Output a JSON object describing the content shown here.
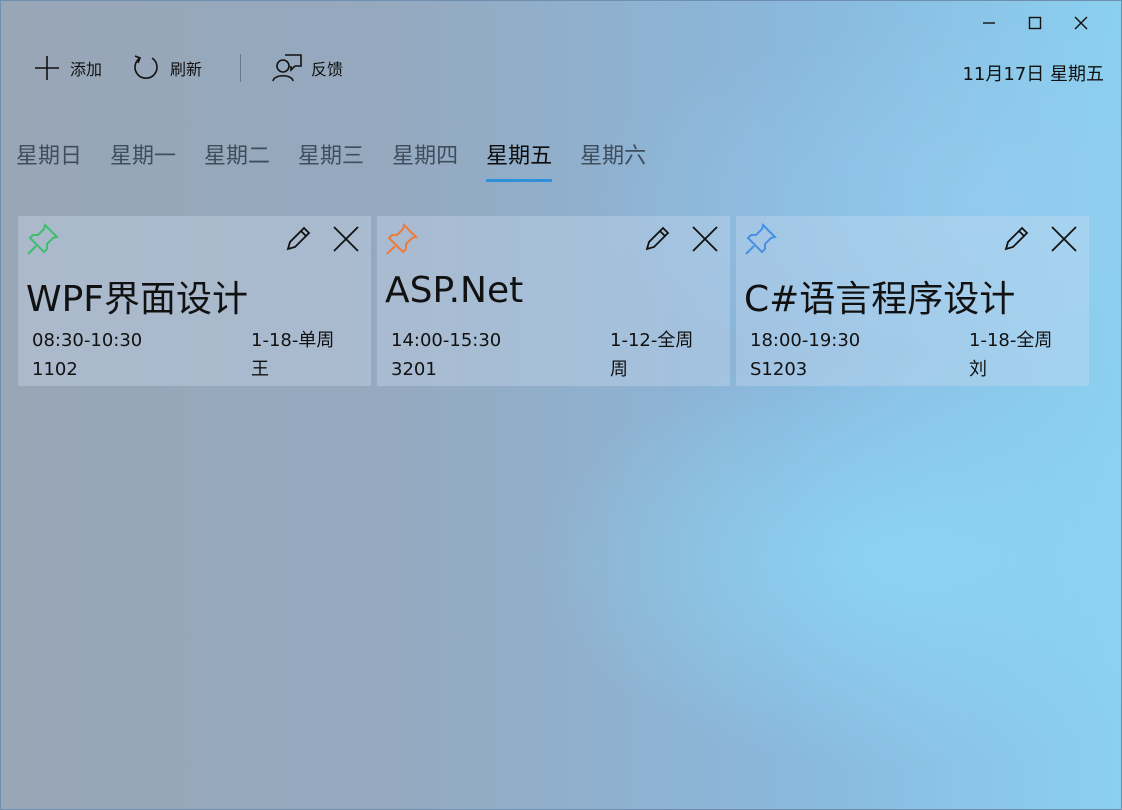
{
  "window": {
    "controls": [
      "minimize",
      "maximize",
      "close"
    ]
  },
  "toolbar": {
    "add_label": "添加",
    "refresh_label": "刷新",
    "feedback_label": "反馈",
    "date_label": "11月17日 星期五"
  },
  "tabs": [
    {
      "label": "星期日",
      "active": false
    },
    {
      "label": "星期一",
      "active": false
    },
    {
      "label": "星期二",
      "active": false
    },
    {
      "label": "星期三",
      "active": false
    },
    {
      "label": "星期四",
      "active": false
    },
    {
      "label": "星期五",
      "active": true
    },
    {
      "label": "星期六",
      "active": false
    }
  ],
  "accent_color": "#2f8fd8",
  "cards": [
    {
      "title": "WPF界面设计",
      "time": "08:30-10:30",
      "weeks": "1-18-单周",
      "room": "1102",
      "teacher": "王",
      "pin_color": "#3dbf6e",
      "pin_icon": "pin-icon"
    },
    {
      "title": "ASP.Net",
      "time": "14:00-15:30",
      "weeks": "1-12-全周",
      "room": "3201",
      "teacher": "周",
      "pin_color": "#ef7a3a",
      "pin_icon": "pin-icon"
    },
    {
      "title": "C#语言程序设计",
      "time": "18:00-19:30",
      "weeks": "1-18-全周",
      "room": "S1203",
      "teacher": "刘",
      "pin_color": "#4a90e2",
      "pin_icon": "pin-icon"
    }
  ]
}
